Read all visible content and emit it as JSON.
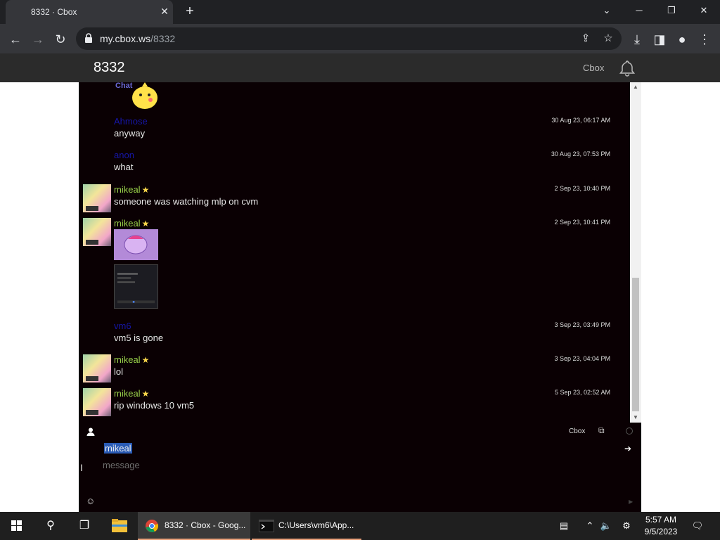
{
  "browser": {
    "tab_title": "8332 · Cbox",
    "tab_close": "✕",
    "new_tab": "+",
    "url_host": "my.cbox.ws",
    "url_path": "/8332",
    "window_buttons": {
      "dropdown": "⌄",
      "minimize": "─",
      "restore": "❐",
      "close": "✕"
    }
  },
  "site": {
    "title": "8332",
    "link": "Cbox"
  },
  "messages": [
    {
      "name": "Ahmose",
      "time": "30 Aug 23, 06:17 AM",
      "text": "anyway"
    },
    {
      "name": "anon",
      "time": "30 Aug 23, 07:53 PM",
      "text": "what"
    },
    {
      "name": "mikeal",
      "time": "2 Sep 23, 10:40 PM",
      "text": "someone was watching mlp on cvm"
    },
    {
      "name": "mikeal",
      "time": "2 Sep 23, 10:41 PM",
      "text": ""
    },
    {
      "name": "vm6",
      "time": "3 Sep 23, 03:49 PM",
      "text": "vm5 is gone"
    },
    {
      "name": "mikeal",
      "time": "3 Sep 23, 04:04 PM",
      "text": "lol"
    },
    {
      "name": "mikeal",
      "time": "5 Sep 23, 02:52 AM",
      "text": "rip windows 10 vm5"
    }
  ],
  "sticker_text": "Chat",
  "input": {
    "cbox_label": "Cbox",
    "name_value": "mikeal",
    "message_placeholder": "message"
  },
  "taskbar": {
    "chrome_label": "8332 · Cbox - Goog...",
    "terminal_label": "C:\\Users\\vm6\\App...",
    "time": "5:57 AM",
    "date": "9/5/2023"
  },
  "colors": {
    "chat_bg": "#0a0003",
    "user_green": "#9ad24b",
    "user_blue": "#1616a8",
    "star": "#f7d64a"
  }
}
